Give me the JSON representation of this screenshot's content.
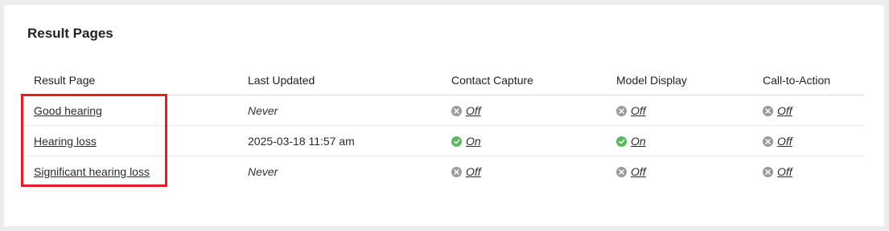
{
  "section": {
    "title": "Result Pages"
  },
  "table": {
    "headers": {
      "result_page": "Result Page",
      "last_updated": "Last Updated",
      "contact_capture": "Contact Capture",
      "model_display": "Model Display",
      "call_to_action": "Call-to-Action"
    },
    "rows": [
      {
        "result_page": "Good hearing",
        "last_updated": "Never",
        "contact_capture": "Off",
        "model_display": "Off",
        "call_to_action": "Off"
      },
      {
        "result_page": "Hearing loss",
        "last_updated": "2025-03-18 11:57 am",
        "contact_capture": "On",
        "model_display": "On",
        "call_to_action": "Off"
      },
      {
        "result_page": "Significant hearing loss",
        "last_updated": "Never",
        "contact_capture": "Off",
        "model_display": "Off",
        "call_to_action": "Off"
      }
    ]
  },
  "icons": {
    "off": "x-circle-icon",
    "on": "check-circle-icon"
  },
  "colors": {
    "on": "#5cb85c",
    "off": "#9a9a9a",
    "highlight": "#e21d24"
  }
}
